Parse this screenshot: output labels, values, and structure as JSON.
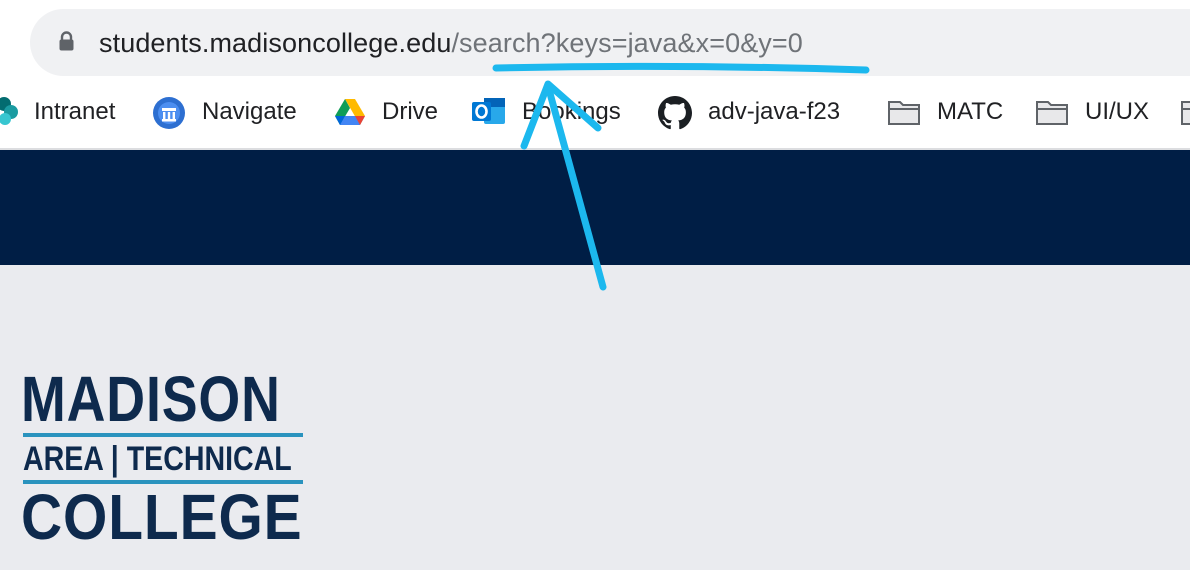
{
  "address_bar": {
    "url_host": "students.madisoncollege.edu",
    "url_path": "/search?keys=java&x=0&y=0",
    "lock_icon": "lock-icon"
  },
  "bookmarks": [
    {
      "label": "Intranet",
      "icon": "sharepoint-icon"
    },
    {
      "label": "Navigate",
      "icon": "navigate-icon"
    },
    {
      "label": "Drive",
      "icon": "google-drive-icon"
    },
    {
      "label": "Bookings",
      "icon": "outlook-icon"
    },
    {
      "label": "adv-java-f23",
      "icon": "github-icon"
    },
    {
      "label": "MATC",
      "icon": "folder-icon"
    },
    {
      "label": "UI/UX",
      "icon": "folder-icon"
    }
  ],
  "logo": {
    "line1": "MADISON",
    "line2": "AREA | TECHNICAL",
    "line3": "COLLEGE"
  },
  "colors": {
    "header_band": "#001e45",
    "page_background": "#eaebef",
    "logo_text": "#0e2a4d",
    "logo_rule": "#2a93be",
    "annotation": "#1cb8ee"
  },
  "annotation": {
    "type": "hand-drawn underline and arrow pointing at the URL query string"
  }
}
